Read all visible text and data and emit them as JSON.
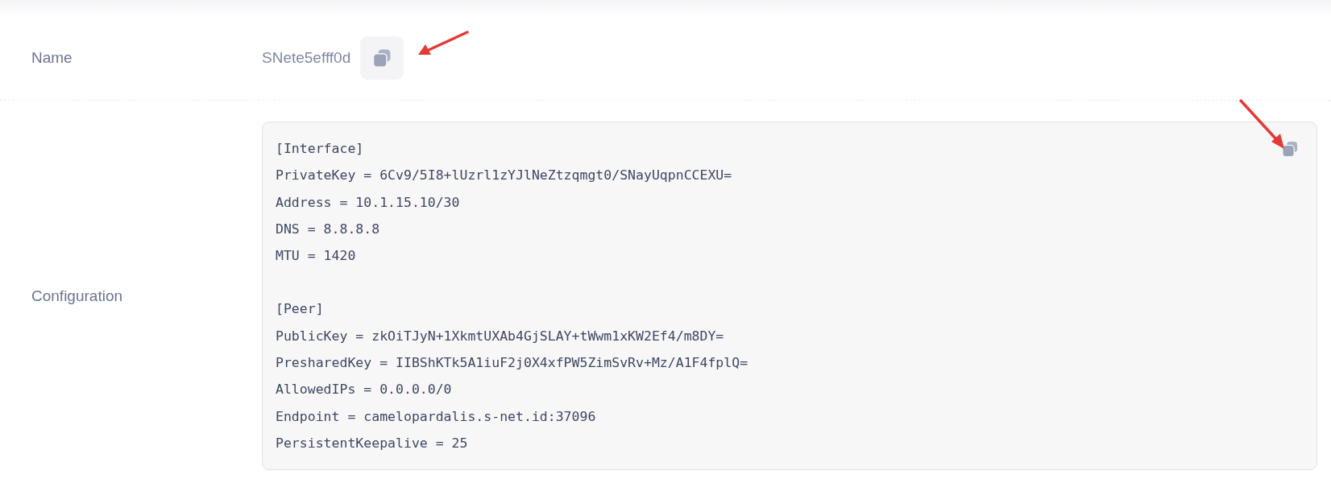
{
  "fields": [
    {
      "label": "Name",
      "value": "SNete5efff0d"
    },
    {
      "label": "Configuration",
      "config": [
        {
          "header": "[Interface]",
          "lines": [
            "PrivateKey = 6Cv9/5I8+lUzrl1zYJlNeZtzqmgt0/SNayUqpnCCEXU=",
            "Address = 10.1.15.10/30",
            "DNS = 8.8.8.8",
            "MTU = 1420"
          ]
        },
        {
          "header": "[Peer]",
          "lines": [
            "PublicKey = zkOiTJyN+1XkmtUXAb4GjSLAY+tWwm1xKW2Ef4/m8DY=",
            "PresharedKey = IIBShKTk5A1iuF2j0X4xfPW5ZimSvRv+Mz/A1F4fplQ=",
            "AllowedIPs = 0.0.0.0/0",
            "Endpoint = camelopardalis.s-net.id:37096",
            "PersistentKeepalive = 25"
          ]
        }
      ]
    }
  ]
}
